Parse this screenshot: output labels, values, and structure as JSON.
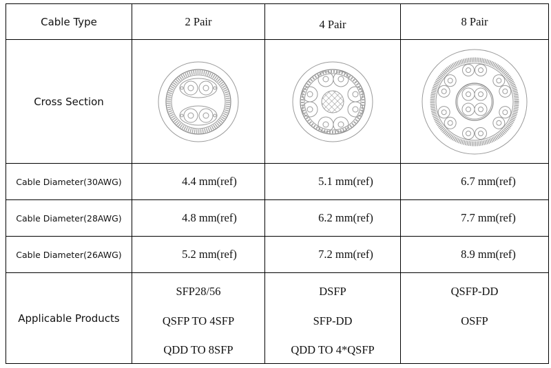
{
  "table": {
    "header": {
      "row_label": "Cable Type",
      "columns": [
        "2 Pair",
        "4 Pair",
        "8 Pair"
      ]
    },
    "cross_section": {
      "row_label": "Cross Section",
      "images": [
        "2-pair-cable-cross-section",
        "4-pair-cable-cross-section",
        "8-pair-cable-cross-section"
      ]
    },
    "diameters": [
      {
        "row_label": "Cable Diameter(30AWG)",
        "values": [
          "4.4  mm(ref)",
          "5.1  mm(ref)",
          "6.7  mm(ref)"
        ]
      },
      {
        "row_label": "Cable Diameter(28AWG)",
        "values": [
          "4.8  mm(ref)",
          "6.2  mm(ref)",
          "7.7  mm(ref)"
        ]
      },
      {
        "row_label": "Cable Diameter(26AWG)",
        "values": [
          "5.2  mm(ref)",
          "7.2  mm(ref)",
          "8.9  mm(ref)"
        ]
      }
    ],
    "products": {
      "row_label": "Applicable Products",
      "columns": [
        [
          "SFP28/56",
          "QSFP TO 4SFP",
          "QDD TO 8SFP"
        ],
        [
          "DSFP",
          "SFP-DD",
          "QDD TO 4*QSFP"
        ],
        [
          "QSFP-DD",
          "OSFP"
        ]
      ]
    }
  }
}
